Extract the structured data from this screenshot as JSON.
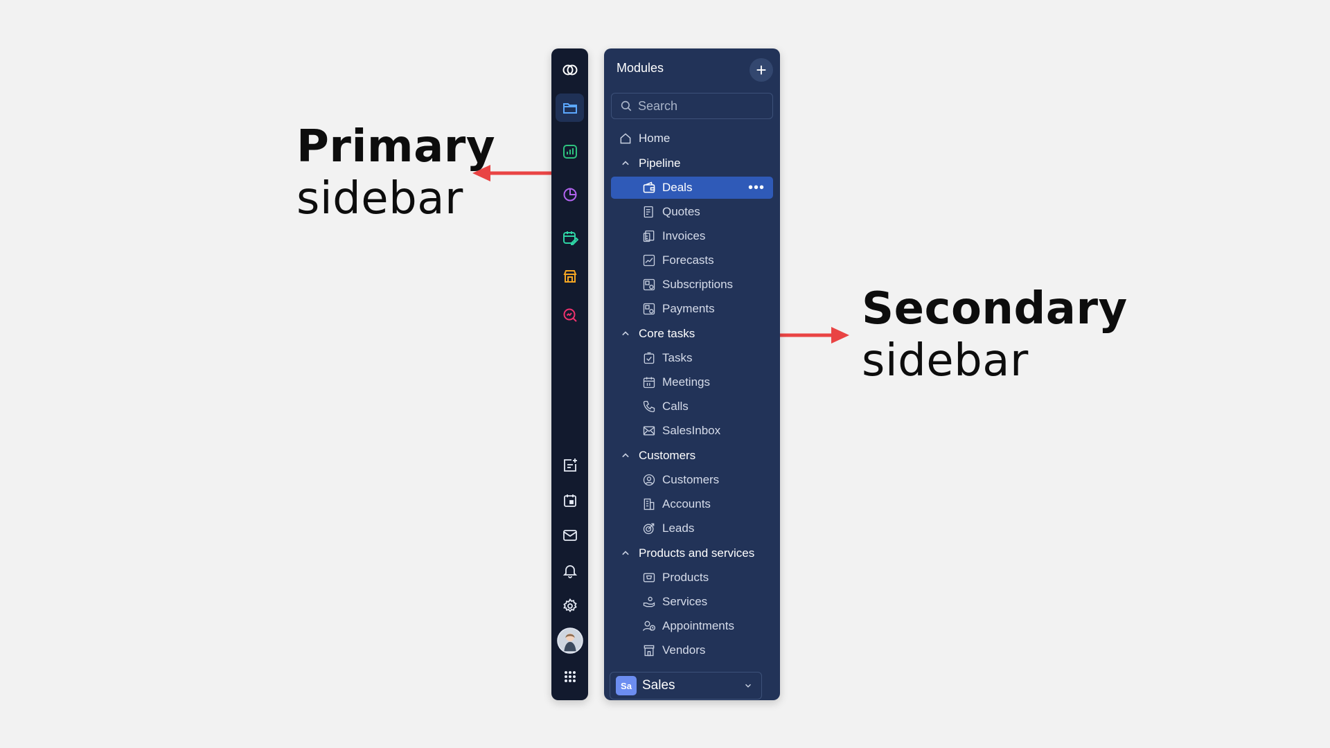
{
  "annotations": {
    "primary": {
      "line1": "Primary",
      "line2": "sidebar"
    },
    "secondary": {
      "line1": "Secondary",
      "line2": "sidebar"
    }
  },
  "colors": {
    "background": "#f2f2f2",
    "primary_sidebar": "#121a2e",
    "secondary_sidebar": "#223358",
    "selected": "#2f5ab8",
    "arrow": "#e94444"
  },
  "primary_sidebar": {
    "top_icons": [
      "logo-icon",
      "folder-icon",
      "chart-icon",
      "pie-chart-icon",
      "calendar-edit-icon",
      "store-icon",
      "search-analytics-icon"
    ],
    "bottom_icons": [
      "add-note-icon",
      "calendar-icon",
      "mail-icon",
      "bell-icon",
      "gear-icon",
      "avatar",
      "apps-grid-icon"
    ],
    "active": "folder-icon"
  },
  "secondary_sidebar": {
    "title": "Modules",
    "add_label": "+",
    "search_placeholder": "Search",
    "home": "Home",
    "groups": [
      {
        "label": "Pipeline",
        "items": [
          "Deals",
          "Quotes",
          "Invoices",
          "Forecasts",
          "Subscriptions",
          "Payments"
        ]
      },
      {
        "label": "Core tasks",
        "items": [
          "Tasks",
          "Meetings",
          "Calls",
          "SalesInbox"
        ]
      },
      {
        "label": "Customers",
        "items": [
          "Customers",
          "Accounts",
          "Leads"
        ]
      },
      {
        "label": "Products and services",
        "items": [
          "Products",
          "Services",
          "Appointments",
          "Vendors"
        ]
      }
    ],
    "selected_item": "Deals",
    "more_label": "•••",
    "app_switcher": {
      "badge": "Sa",
      "name": "Sales"
    }
  }
}
